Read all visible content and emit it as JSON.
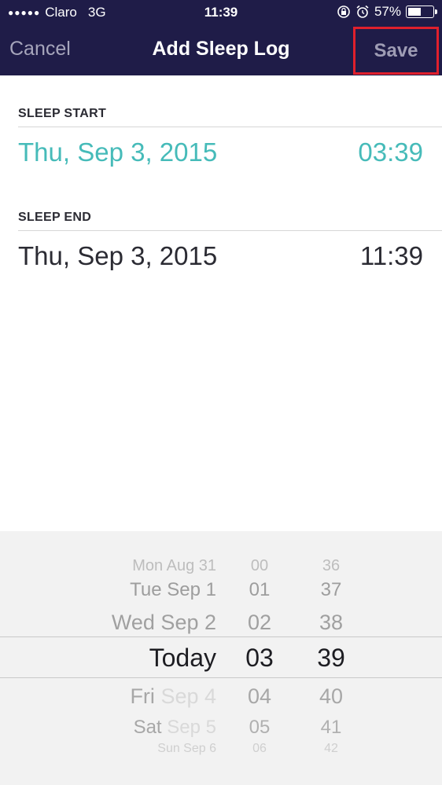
{
  "status_bar": {
    "signal": "●●●●●",
    "carrier": "Claro",
    "network": "3G",
    "time": "11:39",
    "battery_percent": "57%",
    "battery_level": 0.57,
    "icons": [
      "rotation-lock-icon",
      "alarm-icon",
      "battery-icon"
    ]
  },
  "nav": {
    "cancel_label": "Cancel",
    "title": "Add Sleep Log",
    "save_label": "Save"
  },
  "sleep_start": {
    "label": "SLEEP START",
    "date": "Thu, Sep 3, 2015",
    "time": "03:39"
  },
  "sleep_end": {
    "label": "SLEEP END",
    "date": "Thu, Sep 3, 2015",
    "time": "11:39"
  },
  "picker": {
    "dates": [
      "Mon Aug 31",
      "Tue Sep 1",
      "Wed Sep 2",
      "Today",
      "Fri Sep 4",
      "Sat Sep 5",
      "Sun Sep 6"
    ],
    "hours": [
      "00",
      "01",
      "02",
      "03",
      "04",
      "05",
      "06"
    ],
    "minutes": [
      "36",
      "37",
      "38",
      "39",
      "40",
      "41",
      "42"
    ],
    "selected": {
      "date": "Today",
      "hour": "03",
      "minute": "39"
    },
    "colors": {
      "accent": "#46bbb9",
      "header": "#1f1c48",
      "save_highlight": "#e0202c"
    }
  }
}
